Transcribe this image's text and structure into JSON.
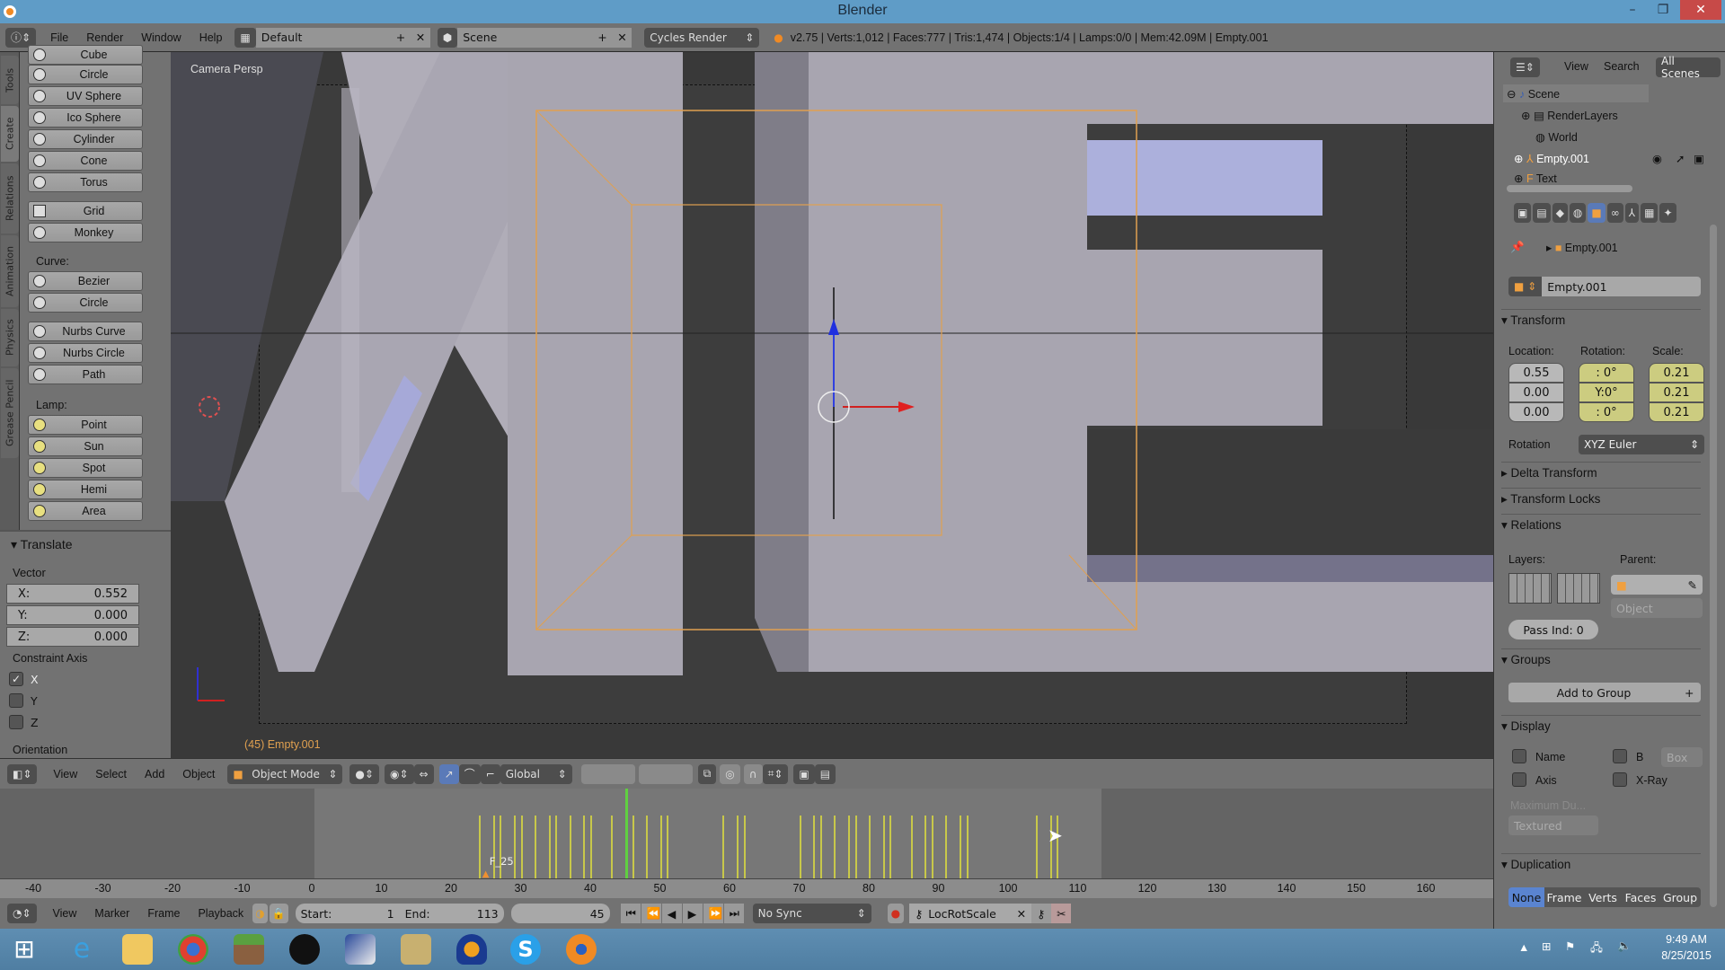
{
  "window": {
    "title": "Blender",
    "minimize_icon": "minimize-icon",
    "maximize_icon": "restore-icon",
    "close_icon": "close-icon"
  },
  "info_header": {
    "menus": [
      "File",
      "Render",
      "Window",
      "Help"
    ],
    "layout": "Default",
    "scene": "Scene",
    "engine": "Cycles Render",
    "stats": "v2.75 | Verts:1,012 | Faces:777 | Tris:1,474 | Objects:1/4 | Lamps:0/0 | Mem:42.09M | Empty.001"
  },
  "tool_tabs": [
    "Tools",
    "Create",
    "Relations",
    "Animation",
    "Physics",
    "Grease Pencil"
  ],
  "tool_shelf": {
    "mesh_items": [
      "Cube",
      "Circle",
      "UV Sphere",
      "Ico Sphere",
      "Cylinder",
      "Cone",
      "Torus"
    ],
    "mesh_items2": [
      "Grid",
      "Monkey"
    ],
    "curve_label": "Curve:",
    "curve_items": [
      "Bezier",
      "Circle"
    ],
    "curve_items2": [
      "Nurbs Curve",
      "Nurbs Circle",
      "Path"
    ],
    "lamp_label": "Lamp:",
    "lamp_items": [
      "Point",
      "Sun",
      "Spot",
      "Hemi",
      "Area"
    ]
  },
  "operator": {
    "title": "Translate",
    "vector_label": "Vector",
    "x_label": "X:",
    "x": "0.552",
    "y_label": "Y:",
    "y": "0.000",
    "z_label": "Z:",
    "z": "0.000",
    "constraint_label": "Constraint Axis",
    "axes": [
      {
        "label": "X",
        "checked": true
      },
      {
        "label": "Y",
        "checked": false
      },
      {
        "label": "Z",
        "checked": false
      }
    ],
    "orientation_label": "Orientation"
  },
  "viewport": {
    "view_name": "Camera Persp",
    "object_info": "(45) Empty.001"
  },
  "view3d_header": {
    "menus": [
      "View",
      "Select",
      "Add",
      "Object"
    ],
    "mode": "Object Mode",
    "orientation": "Global"
  },
  "timeline": {
    "ruler_labels": [
      "-40",
      "-30",
      "-20",
      "-10",
      "0",
      "10",
      "20",
      "30",
      "40",
      "50",
      "60",
      "70",
      "80",
      "90",
      "100",
      "110",
      "120",
      "130",
      "140",
      "150",
      "160"
    ],
    "marker_label": "F_25",
    "current_frame": 45,
    "keyframes": [
      24,
      26,
      27,
      29,
      30,
      32,
      34,
      35,
      37,
      39,
      40,
      43,
      46,
      48,
      50,
      51,
      59,
      61,
      62,
      70,
      72,
      73,
      75,
      77,
      78,
      80,
      82,
      83,
      86,
      88,
      89,
      91,
      93,
      94,
      104,
      106,
      107
    ],
    "menus": [
      "View",
      "Marker",
      "Frame",
      "Playback"
    ],
    "start_label": "Start:",
    "start": "1",
    "end_label": "End:",
    "end": "113",
    "frame": "45",
    "sync": "No Sync",
    "keying_set": "LocRotScale"
  },
  "outliner": {
    "menus": [
      "View",
      "Search"
    ],
    "filter": "All Scenes",
    "items": [
      "Scene",
      "RenderLayers",
      "World",
      "Empty.001",
      "Text"
    ]
  },
  "properties": {
    "breadcrumb": "Empty.001",
    "object_name": "Empty.001",
    "transform": {
      "title": "Transform",
      "location_label": "Location:",
      "rotation_label": "Rotation:",
      "scale_label": "Scale:",
      "location": [
        "0.55",
        "0.00",
        "0.00"
      ],
      "rotation": [
        ": 0°",
        "Y:0°",
        ": 0°"
      ],
      "scale": [
        "0.21",
        "0.21",
        "0.21"
      ],
      "rotation_mode_label": "Rotation",
      "rotation_mode": "XYZ Euler"
    },
    "delta_transform": "Delta Transform",
    "transform_locks": "Transform Locks",
    "relations": {
      "title": "Relations",
      "layers_label": "Layers:",
      "parent_label": "Parent:",
      "parent_type": "Object",
      "pass_index": "Pass Ind: 0"
    },
    "groups": {
      "title": "Groups",
      "add_button": "Add to Group"
    },
    "display": {
      "title": "Display",
      "name": "Name",
      "bounds": "B",
      "bounds_type": "Box",
      "axis": "Axis",
      "xray": "X-Ray",
      "max_draw_label": "Maximum Du...",
      "max_draw": "Textured"
    },
    "duplication": {
      "title": "Duplication",
      "options": [
        "None",
        "Frame",
        "Verts",
        "Faces",
        "Group"
      ],
      "active": "None"
    }
  },
  "taskbar": {
    "apps": [
      "start-button",
      "internet-explorer",
      "file-explorer",
      "chrome",
      "minecraft",
      "obs",
      "paint-app",
      "game-app",
      "audacity",
      "skype",
      "blender"
    ],
    "time": "9:49 AM",
    "date": "8/25/2015"
  }
}
